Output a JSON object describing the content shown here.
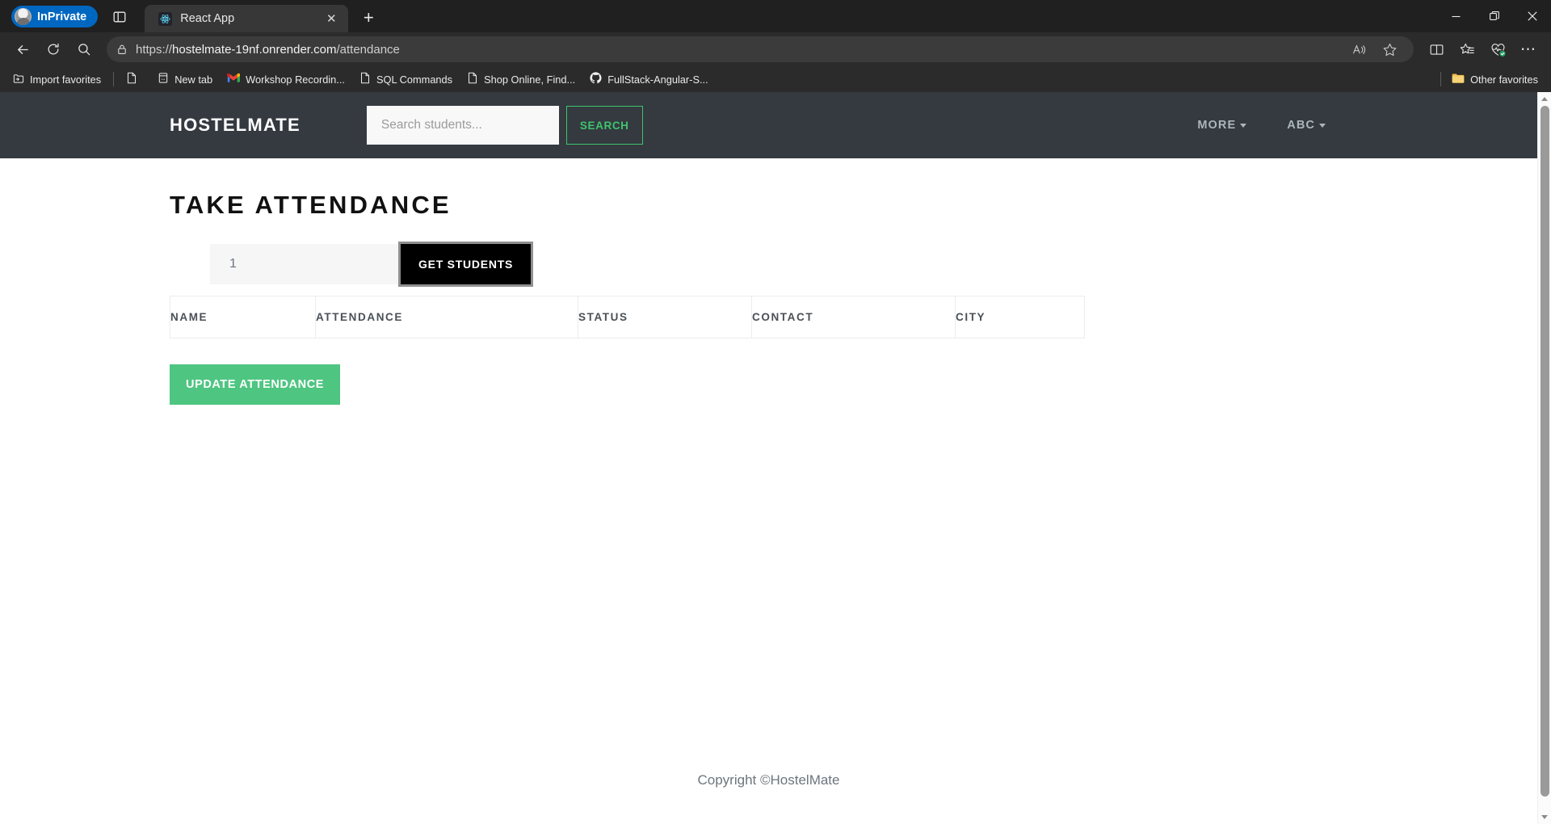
{
  "browser": {
    "profile_label": "InPrivate",
    "tab": {
      "title": "React App",
      "favicon": "react-icon",
      "close_label": "✕"
    },
    "new_tab_label": "+",
    "window_controls": {
      "minimize": "—",
      "restore": "❐",
      "close": "✕"
    },
    "toolbar": {
      "back": "back-arrow-icon",
      "refresh": "refresh-icon",
      "search": "search-icon",
      "read_aloud": "read-aloud-icon",
      "favorite": "star-icon",
      "split_screen": "split-screen-icon",
      "collections": "collections-icon",
      "browser_essentials": "browser-essentials-icon",
      "settings": "⋯"
    },
    "address": {
      "scheme": "https://",
      "host": "hostelmate-19nf.onrender.com",
      "path": "/attendance",
      "full": "https://hostelmate-19nf.onrender.com/attendance"
    },
    "bookmarks": [
      {
        "label": "Import favorites",
        "icon": "import-favorites-icon"
      },
      {
        "label": "",
        "icon": "page-icon"
      },
      {
        "label": "New tab",
        "icon": "new-tab-icon"
      },
      {
        "label": "Workshop Recordin...",
        "icon": "gmail-icon"
      },
      {
        "label": "SQL Commands",
        "icon": "page-icon"
      },
      {
        "label": "Shop Online, Find...",
        "icon": "page-icon"
      },
      {
        "label": "FullStack-Angular-S...",
        "icon": "github-icon"
      }
    ],
    "other_favorites": {
      "label": "Other favorites",
      "icon": "folder-icon"
    }
  },
  "site": {
    "navbar": {
      "brand": "HOSTELMATE",
      "search_placeholder": "Search students...",
      "search_value": "",
      "search_button": "SEARCH",
      "links": [
        {
          "label": "MORE",
          "has_caret": true
        },
        {
          "label": "ABC",
          "has_caret": true
        }
      ]
    },
    "main": {
      "title": "TAKE ATTENDANCE",
      "count_value": "1",
      "count_placeholder": "1",
      "get_students_button": "GET STUDENTS",
      "table": {
        "columns": [
          "NAME",
          "ATTENDANCE",
          "STATUS",
          "CONTACT",
          "CITY"
        ],
        "rows": []
      },
      "update_button": "UPDATE ATTENDANCE"
    },
    "footer": {
      "copyright": "Copyright ©HostelMate"
    },
    "colors": {
      "navbar_bg": "#343a40",
      "accent_green": "#3ec46d",
      "update_green": "#4ec581",
      "button_black": "#000000"
    }
  }
}
